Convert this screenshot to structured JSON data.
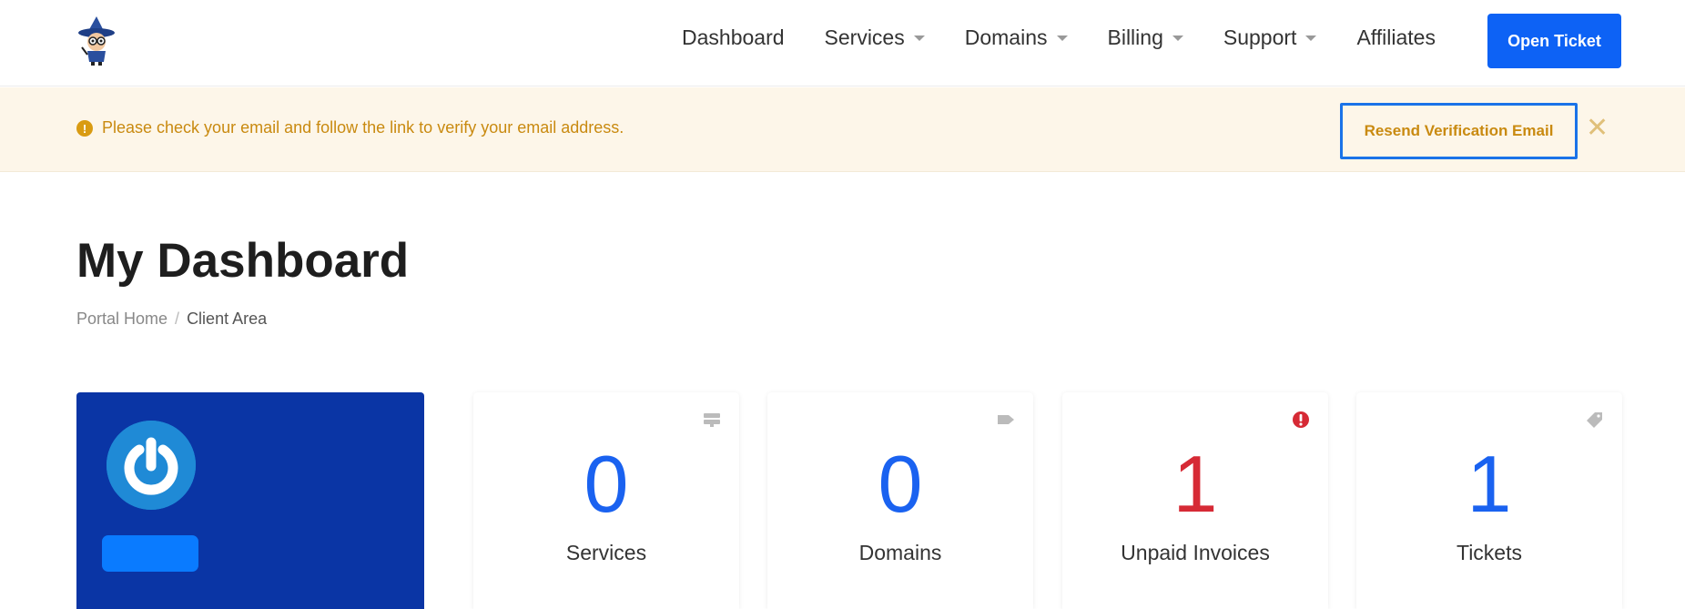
{
  "header": {
    "logo_icon": "wizard-mascot-logo",
    "nav": [
      {
        "label": "Dashboard",
        "dropdown": false
      },
      {
        "label": "Services",
        "dropdown": true
      },
      {
        "label": "Domains",
        "dropdown": true
      },
      {
        "label": "Billing",
        "dropdown": true
      },
      {
        "label": "Support",
        "dropdown": true
      },
      {
        "label": "Affiliates",
        "dropdown": false
      }
    ],
    "open_ticket_label": "Open Ticket"
  },
  "alert": {
    "icon": "exclamation-circle-icon",
    "message": "Please check your email and follow the link to verify your email address.",
    "resend_label": "Resend Verification Email",
    "close_glyph": "✕"
  },
  "page": {
    "title": "My Dashboard",
    "breadcrumb": [
      {
        "label": "Portal Home"
      },
      {
        "label": "Client Area"
      }
    ]
  },
  "profile_card": {
    "icon": "power-icon"
  },
  "stats": [
    {
      "value": "0",
      "label": "Services",
      "icon": "server-icon",
      "color": "#1a62f0"
    },
    {
      "value": "0",
      "label": "Domains",
      "icon": "tag-icon",
      "color": "#1a62f0"
    },
    {
      "value": "1",
      "label": "Unpaid Invoices",
      "icon": "exclamation-circle-icon",
      "color": "#d62a35"
    },
    {
      "value": "1",
      "label": "Tickets",
      "icon": "ticket-icon",
      "color": "#1a62f0"
    }
  ],
  "colors": {
    "primary": "#0d62f5",
    "alert_bg": "#fdf6e9",
    "alert_text": "#c98a10",
    "danger": "#d62a35",
    "profile_bg": "#0a35a5"
  }
}
